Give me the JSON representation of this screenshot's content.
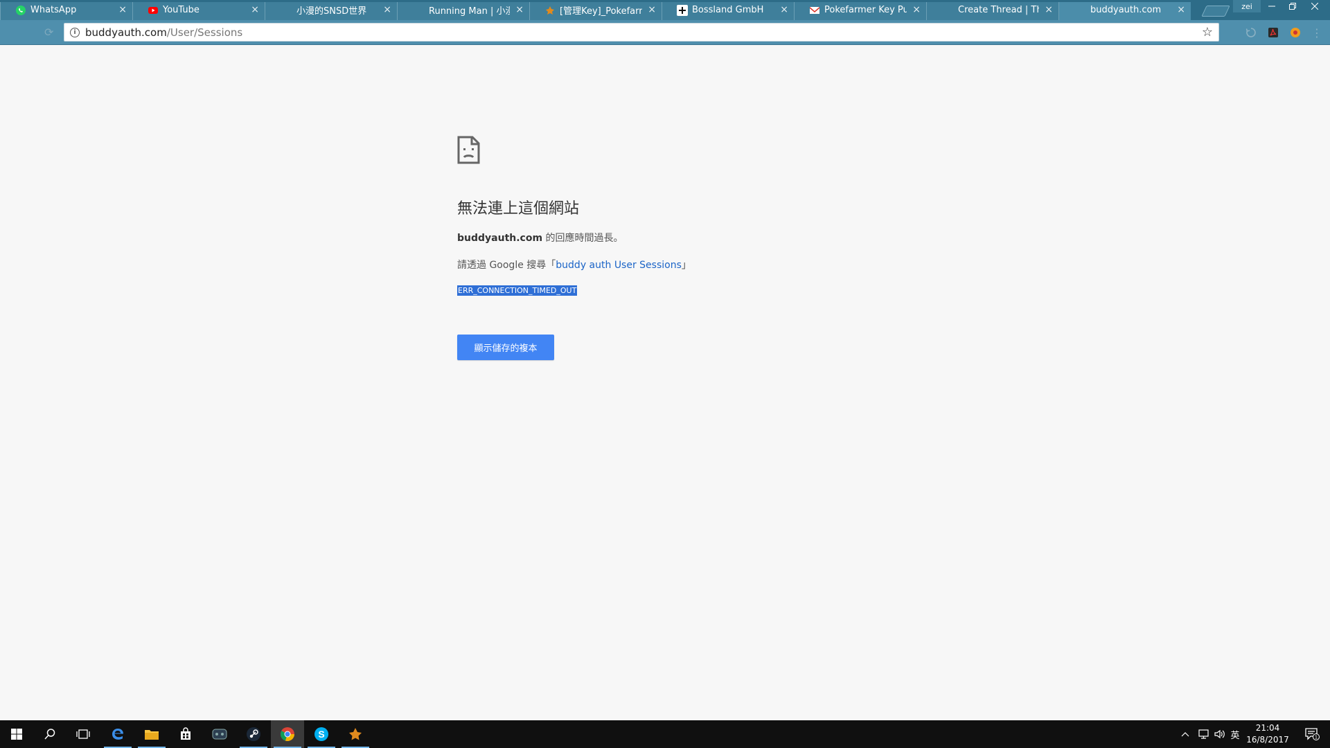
{
  "browser": {
    "tabs": [
      {
        "title": "WhatsApp",
        "icon": "whatsapp-icon",
        "color": "#25d366"
      },
      {
        "title": "YouTube",
        "icon": "youtube-icon",
        "color": "#ff0000"
      },
      {
        "title": "小漫的SNSD世界",
        "icon": "",
        "color": ""
      },
      {
        "title": "Running Man | 小漫的S",
        "icon": "",
        "color": ""
      },
      {
        "title": "[管理Key]_Pokefarmer",
        "icon": "pokefarmer-icon",
        "color": "#e08a1e"
      },
      {
        "title": "Bossland GmbH",
        "icon": "bossland-icon",
        "color": "#111111"
      },
      {
        "title": "Pokefarmer Key Purch",
        "icon": "gmail-icon",
        "color": "#d93025"
      },
      {
        "title": "Create Thread | The Bu",
        "icon": "",
        "color": ""
      },
      {
        "title": "buddyauth.com",
        "icon": "",
        "color": "",
        "active": true
      }
    ],
    "window_user": "zei",
    "address": {
      "host": "buddyauth.com",
      "path": "/User/Sessions"
    }
  },
  "error_page": {
    "title": "無法連上這個網站",
    "desc_host": "buddyauth.com",
    "desc_suffix": " 的回應時間過長。",
    "suggest_prefix": "請透過 Google 搜尋「",
    "suggest_link": "buddy auth User Sessions",
    "suggest_suffix": "」",
    "error_code": "ERR_CONNECTION_TIMED_OUT",
    "button_label": "顯示儲存的複本"
  },
  "taskbar": {
    "time": "21:04",
    "date": "16/8/2017",
    "ime": "英",
    "notifications": "1"
  },
  "colors": {
    "tabstrip": "#2d6c88",
    "toolbar": "#4f8fad",
    "button_blue": "#4285f4",
    "link_blue": "#1b64c7"
  }
}
